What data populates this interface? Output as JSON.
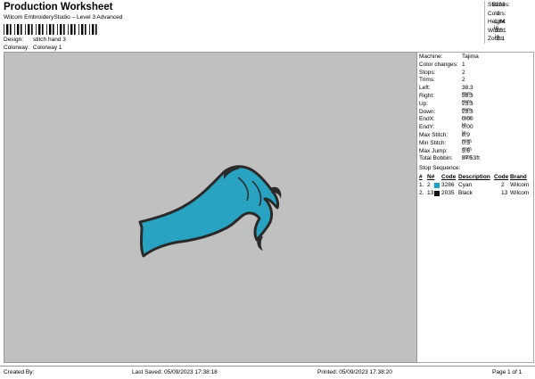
{
  "header": {
    "title": "Production Worksheet",
    "subtitle": "Wilcom EmbroideryStudio – Level 3 Advanced",
    "design_label": "Design:",
    "design_value": "stitch hand 3",
    "colorway_label": "Colorway:",
    "colorway_value": "Colorway 1"
  },
  "summary": [
    {
      "label": "Stitches:",
      "value": "5323"
    },
    {
      "label": "Colors:",
      "value": "2"
    },
    {
      "label": "Height:",
      "value": "1.84 in"
    },
    {
      "label": "Width:",
      "value": "3.01 in"
    },
    {
      "label": "Zoom:",
      "value": "1:1"
    }
  ],
  "machine_info": [
    {
      "label": "Machine:",
      "value": "Tajima"
    },
    {
      "label": "Color changes:",
      "value": "1"
    },
    {
      "label": "Stops:",
      "value": "2"
    },
    {
      "label": "Trims:",
      "value": "2"
    },
    {
      "label": "Left:",
      "value": "38.3 mm"
    },
    {
      "label": "Right:",
      "value": "38.3 mm"
    },
    {
      "label": "Up:",
      "value": "23.3 mm"
    },
    {
      "label": "Down:",
      "value": "23.3 mm"
    },
    {
      "label": "EndX:",
      "value": "0.00 in"
    },
    {
      "label": "EndY:",
      "value": "0.00 in"
    },
    {
      "label": "Max Stitch:",
      "value": "8.9 mm"
    },
    {
      "label": "Min Stitch:",
      "value": "0.3 mm"
    },
    {
      "label": "Max Jump:",
      "value": "3.6 mm"
    },
    {
      "label": "Total Bobbin:",
      "value": "37.53ft"
    }
  ],
  "stop_sequence": {
    "title": "Stop Sequence:",
    "headers": [
      "#",
      "N#",
      "Code",
      "Description",
      "Code",
      "Brand"
    ],
    "rows": [
      {
        "index": "1.",
        "needle": "2",
        "code": "3286",
        "description": "Cyan",
        "code2": "2",
        "brand": "Wilcom",
        "color": "#1fa0c9"
      },
      {
        "index": "2.",
        "needle": "13",
        "code": "2035",
        "description": "Black",
        "code2": "13",
        "brand": "Wilcom",
        "color": "#111111"
      }
    ]
  },
  "footer": {
    "created_by": "Created By:",
    "last_saved": "Last Saved: 05/09/2023 17:38:18",
    "printed": "Printed: 05/09/2023 17:38:20",
    "page": "Page 1 of 1"
  },
  "design_colors": {
    "fill": "#2aa6c4",
    "outline": "#2a2a2a",
    "background": "#c0c0c0"
  }
}
